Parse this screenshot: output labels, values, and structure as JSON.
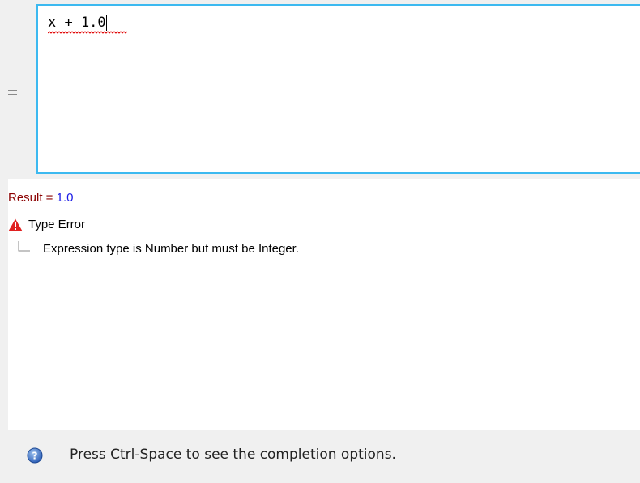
{
  "editor": {
    "expression": "x + 1.0",
    "gutter_icon": "drag-handle-icon",
    "focus_border_color": "#3cb9f0"
  },
  "result": {
    "label": "Result = ",
    "value": "1.0",
    "label_color": "#8b0000",
    "value_color": "#1a1ae6"
  },
  "error": {
    "icon": "warning-icon",
    "title": "Type Error",
    "detail": "Expression type is Number but must be Integer.",
    "icon_color": "#e02020"
  },
  "status_bar": {
    "icon": "info-icon",
    "message": "Press Ctrl-Space to see the completion options."
  }
}
